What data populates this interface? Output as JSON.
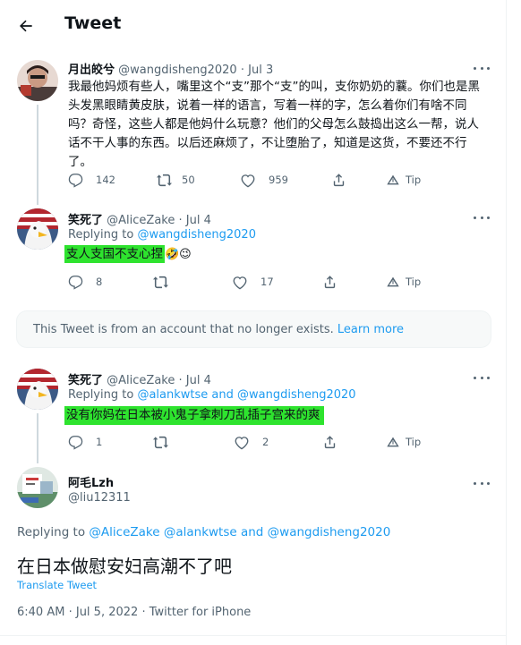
{
  "header": {
    "title": "Tweet"
  },
  "tweets": [
    {
      "name": "月出皎兮",
      "handle": "@wangdisheng2020",
      "sep": "·",
      "date": "Jul 3",
      "text": "我最他妈烦有些人，嘴里这个“支”那个“支”的叫，支你奶奶的蘘。你们也是黑头发黑眼睛黄皮肤，说着一样的语言，写着一样的字，怎么着你们有啥不同吗？奇怪，这些人都是他妈什么玩意？他们的父母怎么鼓捣出这么一帮，说人话不干人事的东西。以后还麻烦了，不让堕胎了，知道是这货，不要还不行了。",
      "replies": "142",
      "retweets": "50",
      "likes": "959",
      "tip": "Tip"
    },
    {
      "name": "笑死了",
      "handle": "@AliceZake",
      "sep": "·",
      "date": "Jul 4",
      "replying_prefix": "Replying to ",
      "replying_to": "@wangdisheng2020",
      "text": "支人支国不支心捏",
      "emoji": "🤣😉",
      "replies": "8",
      "retweets": "",
      "likes": "17",
      "tip": "Tip"
    },
    {
      "name": "笑死了",
      "handle": "@AliceZake",
      "sep": "·",
      "date": "Jul 4",
      "replying_prefix": "Replying to ",
      "replying_to_1": "@alankwtse",
      "replying_and": " and ",
      "replying_to_2": "@wangdisheng2020",
      "text": "没有你妈在日本被小鬼子拿刺刀乱插子宫来的爽",
      "replies": "1",
      "retweets": "",
      "likes": "2",
      "tip": "Tip"
    }
  ],
  "notice": {
    "text": "This Tweet is from an account that no longer exists. ",
    "link": "Learn more"
  },
  "main_tweet": {
    "name": "阿毛Lzh",
    "handle": "@liu12311",
    "replying_prefix": "Replying to ",
    "replying_to_1": "@AliceZake",
    "replying_to_2": "@alankwtse",
    "replying_and": " and ",
    "replying_to_3": "@wangdisheng2020",
    "text": "在日本做慰安妇高潮不了吧",
    "translate": "Translate Tweet",
    "time": "6:40 AM",
    "sep1": "·",
    "date": "Jul 5, 2022",
    "sep2": "·",
    "source": "Twitter for iPhone"
  },
  "colors": {
    "accent": "#1d9bf0",
    "highlight": "#2ee32e",
    "muted": "#536471"
  },
  "icons": [
    "back-arrow-icon",
    "more-icon",
    "reply-icon",
    "retweet-icon",
    "like-icon",
    "share-icon",
    "tip-icon"
  ]
}
